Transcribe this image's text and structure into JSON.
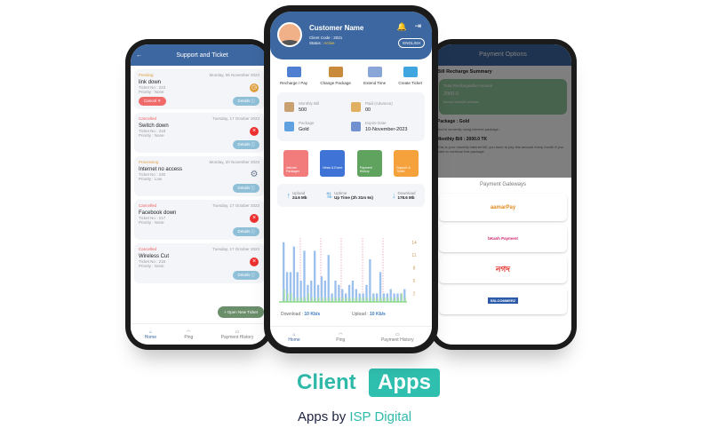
{
  "left": {
    "title": "Support and Ticket",
    "tickets": [
      {
        "status": "Pending",
        "date": "Monday, 06 November 2023",
        "title": "link down",
        "ticket_no": "Ticket No : 223",
        "priority": "Priority : None",
        "cancel": "Cancel",
        "details": "Details",
        "icon": "clock-icon"
      },
      {
        "status": "Cancelled",
        "date": "Tuesday, 17 October 2023",
        "title": "Switch down",
        "ticket_no": "Ticket No : 218",
        "priority": "Priority : None",
        "details": "Details",
        "icon": "x-icon"
      },
      {
        "status": "Processing",
        "date": "Monday, 20 November 2023",
        "title": "Internet no access",
        "ticket_no": "Ticket No : 230",
        "priority": "Priority : Low",
        "details": "Details",
        "icon": "gear-icon"
      },
      {
        "status": "Cancelled",
        "date": "Tuesday, 17 October 2023",
        "title": "Facebook down",
        "ticket_no": "Ticket No : 217",
        "priority": "Priority : None",
        "details": "Details",
        "icon": "x-icon"
      },
      {
        "status": "Cancelled",
        "date": "Tuesday, 17 October 2023",
        "title": "Wireless Cut",
        "ticket_no": "Ticket No : 216",
        "priority": "Priority : None",
        "details": "Details",
        "icon": "x-icon"
      }
    ],
    "fab": "Open New Ticket"
  },
  "nav": {
    "home": "Home",
    "ping": "Ping",
    "payment": "Payment History"
  },
  "center": {
    "name": "Customer Name",
    "client_code": "Client Code :  2021",
    "status_label": "Status : ",
    "status": "Active",
    "lang": "ENGLISH",
    "actions": [
      "Recharge / Pay",
      "Change Package",
      "Extend Time",
      "Create Ticket"
    ],
    "info": [
      {
        "label": "Monthly Bill",
        "value": "500"
      },
      {
        "label": "Paid (Advance)",
        "value": "00"
      },
      {
        "label": "Package",
        "value": "Gold"
      },
      {
        "label": "Expire Date",
        "value": "10-November-2023"
      }
    ],
    "tiles": [
      {
        "label": "Internet Packages",
        "color": "#f27b7b"
      },
      {
        "label": "News & Event",
        "color": "#3f74d6"
      },
      {
        "label": "Payment History",
        "color": "#5fa35f"
      },
      {
        "label": "Support & Ticket",
        "color": "#f5a23c"
      }
    ],
    "speed": {
      "upload_label": "Upload",
      "upload": "24.6 Mb",
      "uptime_label": "Uptime",
      "uptime": "Up Time (2h 31m 6s)",
      "download_label": "Download",
      "download": "178.6 Mb"
    },
    "download_label": "Download : ",
    "download_rate": "10 Kb/s",
    "upload_label": "Upload : ",
    "upload_rate": "10 Kb/s"
  },
  "chart_data": {
    "type": "bar",
    "yticks": [
      14,
      11,
      8,
      5,
      2
    ],
    "ylim": [
      0,
      15
    ],
    "values": [
      14,
      7,
      7,
      13,
      7,
      5,
      12,
      4,
      5,
      12,
      4,
      6,
      5,
      11,
      2,
      5,
      4,
      3,
      2,
      4,
      5,
      3,
      2,
      2,
      4,
      10,
      2,
      2,
      7,
      2,
      2,
      3,
      2,
      2,
      2,
      3
    ],
    "upload_values": [
      3,
      2,
      2,
      1,
      1,
      1,
      1,
      2,
      1,
      1,
      1,
      1,
      1,
      1,
      1,
      1,
      1,
      1,
      1,
      1,
      1,
      1,
      1,
      1,
      1,
      1,
      1,
      1,
      1,
      1,
      1,
      1,
      1,
      1,
      2,
      1
    ]
  },
  "right": {
    "title": "Payment Options",
    "summary": "Bill Recharge Summary",
    "total_label": "Total Rechargeable Amount",
    "total": "2000.0",
    "taxes": "Amount Includes all taxes",
    "package": "Package :   Gold",
    "using": "You're currently using internet package :",
    "monthly": "Monthly Bill :   2000.0   TK",
    "note": "This is your monthly internet bill, you have to pay this amount every month if you want to continue this package",
    "gateways_title": "Payment Gateways",
    "gateways": [
      "aamarPay",
      "bKash Payment",
      "নগদ",
      "SSLCOMMERZ"
    ]
  },
  "brand": {
    "client": "Client",
    "apps": "Apps",
    "sub": "Apps by ",
    "isp": "ISP Digital",
    "accent": "#2fbfae"
  }
}
